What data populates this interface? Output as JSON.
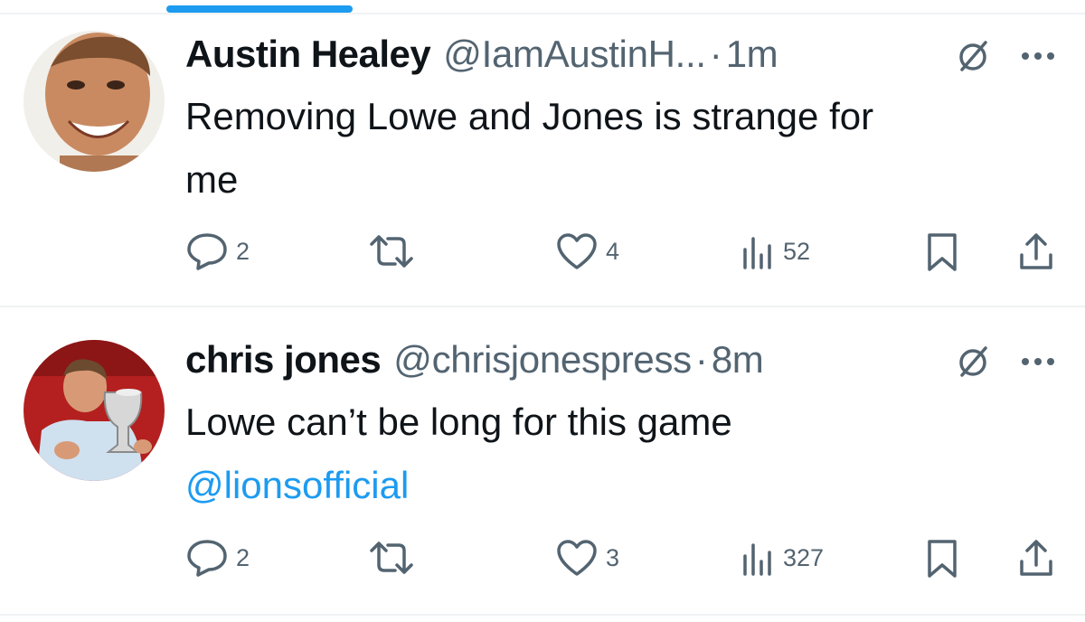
{
  "colors": {
    "accent": "#1d9bf0",
    "secondary_text": "#536471",
    "primary_text": "#0f1419",
    "divider": "#eff3f4"
  },
  "tweets": [
    {
      "display_name": "Austin Healey",
      "handle": "@IamAustinH...",
      "separator": "·",
      "time": "1m",
      "text_lines": [
        "Removing Lowe and Jones is strange for",
        "me"
      ],
      "mention": "",
      "replies": "2",
      "likes": "4",
      "views": "52",
      "avatar_icon": "avatar-smiling-man"
    },
    {
      "display_name": "chris jones",
      "handle": "@chrisjonespress",
      "separator": "·",
      "time": "8m",
      "text_lines": [
        "Lowe can’t be long for this game"
      ],
      "mention": "@lionsofficial",
      "replies": "2",
      "likes": "3",
      "views": "327",
      "avatar_icon": "avatar-man-with-trophy"
    }
  ]
}
